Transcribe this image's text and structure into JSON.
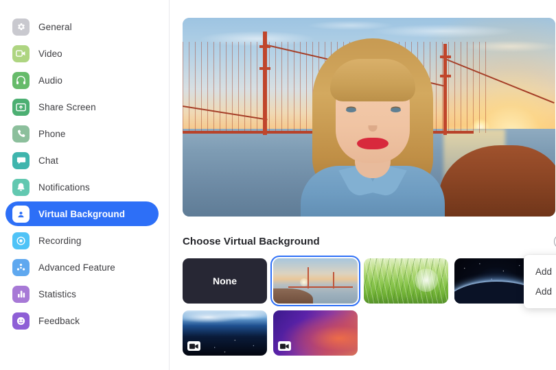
{
  "sidebar": {
    "items": [
      {
        "label": "General",
        "icon": "gear-icon",
        "color": "#c9c9cf",
        "selected": false
      },
      {
        "label": "Video",
        "icon": "video-camera-icon",
        "color": "#aed581",
        "selected": false
      },
      {
        "label": "Audio",
        "icon": "headphones-icon",
        "color": "#66bb6a",
        "selected": false
      },
      {
        "label": "Share Screen",
        "icon": "share-screen-icon",
        "color": "#4caf72",
        "selected": false
      },
      {
        "label": "Phone",
        "icon": "phone-icon",
        "color": "#8cbf9c",
        "selected": false
      },
      {
        "label": "Chat",
        "icon": "chat-bubble-icon",
        "color": "#3fb5ad",
        "selected": false
      },
      {
        "label": "Notifications",
        "icon": "bell-icon",
        "color": "#62c8b0",
        "selected": false
      },
      {
        "label": "Virtual Background",
        "icon": "person-card-icon",
        "color": "#2D6FF7",
        "selected": true
      },
      {
        "label": "Recording",
        "icon": "record-circle-icon",
        "color": "#4fc3f7",
        "selected": false
      },
      {
        "label": "Advanced Feature",
        "icon": "advanced-feature-icon",
        "color": "#5fa8ef",
        "selected": false
      },
      {
        "label": "Statistics",
        "icon": "bar-chart-icon",
        "color": "#a779d6",
        "selected": false
      },
      {
        "label": "Feedback",
        "icon": "smiley-face-icon",
        "color": "#8e5fd6",
        "selected": false
      }
    ]
  },
  "preview": {
    "alt": "video-self-preview-with-golden-gate-bridge-background"
  },
  "main": {
    "section_title": "Choose Virtual Background",
    "add_button_label": "+",
    "add_menu": {
      "items": [
        "Add",
        "Add"
      ]
    },
    "thumbnails": [
      {
        "name": "none",
        "label": "None",
        "type": "none",
        "selected": false,
        "has_video_badge": false
      },
      {
        "name": "golden-gate",
        "label": "",
        "type": "image",
        "selected": true,
        "has_video_badge": false
      },
      {
        "name": "grass",
        "label": "",
        "type": "image",
        "selected": false,
        "has_video_badge": false
      },
      {
        "name": "earth-space",
        "label": "",
        "type": "image",
        "selected": false,
        "has_video_badge": false
      },
      {
        "name": "earth-horizon",
        "label": "",
        "type": "video",
        "selected": false,
        "has_video_badge": true
      },
      {
        "name": "gradient",
        "label": "",
        "type": "video",
        "selected": false,
        "has_video_badge": true
      }
    ]
  },
  "colors": {
    "accent": "#2D6FF7",
    "text": "#3c3c40",
    "heading": "#25262b",
    "none_thumb": "#272734",
    "divider": "#e9e9ed"
  }
}
